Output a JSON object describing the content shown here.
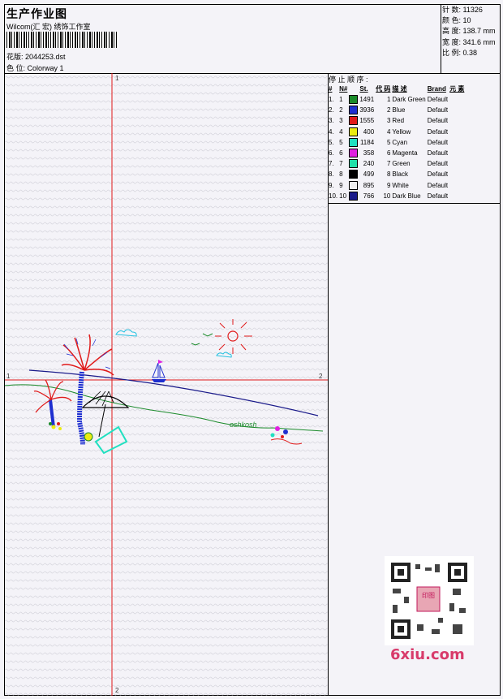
{
  "header": {
    "title": "生产作业图",
    "studio": "Wilcom(汇 宏) 绣饰工作室",
    "design": "花版: 2044253.dst",
    "colorway": "色 位: Colorway 1"
  },
  "stats": {
    "stitches": "针 数: 11326",
    "colors": "颜 色: 10",
    "height": "高 度: 138.7 mm",
    "width": "宽 度: 341.6 mm",
    "scale": "比 例: 0.38"
  },
  "stop_sequence": {
    "label": "停 止 顺 序 :",
    "headers": [
      "#",
      "N#",
      "St.",
      "代 码",
      "描 述",
      "Brand",
      "元 素"
    ],
    "rows": [
      {
        "idx": "1.",
        "n": "1",
        "color": "#1a8a2a",
        "st": "1491",
        "code": "1",
        "desc": "Dark Green",
        "brand": "Default"
      },
      {
        "idx": "2.",
        "n": "2",
        "color": "#1e2fd0",
        "st": "3936",
        "code": "2",
        "desc": "Blue",
        "brand": "Default"
      },
      {
        "idx": "3.",
        "n": "3",
        "color": "#e01a1a",
        "st": "1555",
        "code": "3",
        "desc": "Red",
        "brand": "Default"
      },
      {
        "idx": "4.",
        "n": "4",
        "color": "#ecec10",
        "st": "400",
        "code": "4",
        "desc": "Yellow",
        "brand": "Default"
      },
      {
        "idx": "5.",
        "n": "5",
        "color": "#20e0c0",
        "st": "1184",
        "code": "5",
        "desc": "Cyan",
        "brand": "Default"
      },
      {
        "idx": "6.",
        "n": "6",
        "color": "#e020e0",
        "st": "358",
        "code": "6",
        "desc": "Magenta",
        "brand": "Default"
      },
      {
        "idx": "7.",
        "n": "7",
        "color": "#20e0a8",
        "st": "240",
        "code": "7",
        "desc": "Green",
        "brand": "Default"
      },
      {
        "idx": "8.",
        "n": "8",
        "color": "#000000",
        "st": "499",
        "code": "8",
        "desc": "Black",
        "brand": "Default"
      },
      {
        "idx": "9.",
        "n": "9",
        "color": "#f0f0f0",
        "st": "895",
        "code": "9",
        "desc": "White",
        "brand": "Default"
      },
      {
        "idx": "10.",
        "n": "10",
        "color": "#1a1a8a",
        "st": "766",
        "code": "10",
        "desc": "Dark Blue",
        "brand": "Default"
      }
    ]
  },
  "axis_labels": {
    "v_top": "1",
    "v_bottom": "2",
    "h_left": "1",
    "h_right": "2"
  },
  "watermark": {
    "text": "6xiu.com",
    "qr_stamp": "印图"
  },
  "colors": {
    "axis": "#e01a1a",
    "frame": "#000000",
    "background": "#f4f3f8"
  }
}
